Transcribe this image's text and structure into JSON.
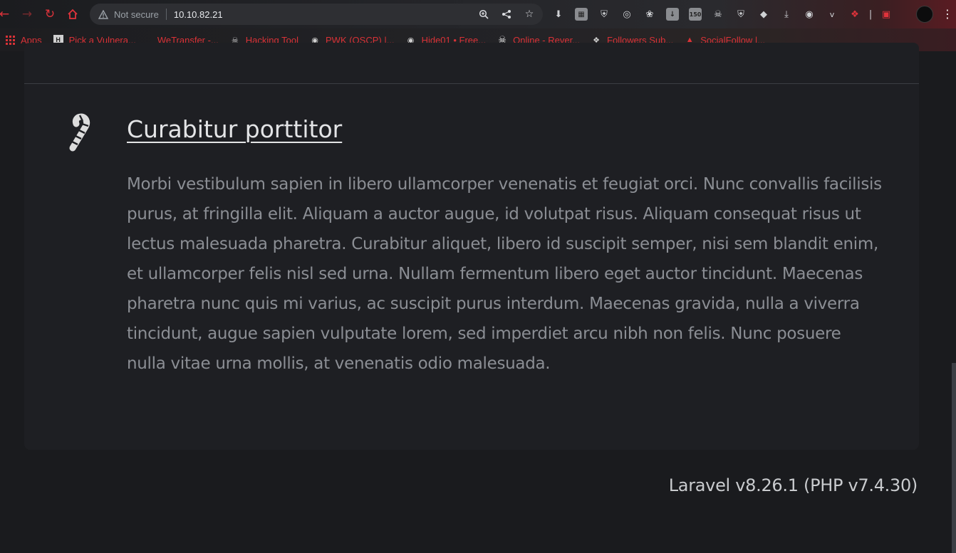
{
  "browser": {
    "security_label": "Not secure",
    "url": "10.10.82.21",
    "bookmarks": [
      {
        "label": "Apps",
        "icon": "apps-grid-icon"
      },
      {
        "label": "Pick a Vulnera...",
        "icon": "hacker-icon"
      },
      {
        "label": "WeTransfer -...",
        "icon": "wetransfer-icon"
      },
      {
        "label": "Hacking Tool",
        "icon": "skull-icon"
      },
      {
        "label": "PWK (OSCP) |...",
        "icon": "globe-icon"
      },
      {
        "label": "Hide01 • Free...",
        "icon": "globe-icon"
      },
      {
        "label": "Online - Rever...",
        "icon": "skull-icon"
      },
      {
        "label": "Followers Sub...",
        "icon": "puzzle-icon"
      },
      {
        "label": "SocialFollow |...",
        "icon": "social-icon"
      }
    ],
    "extension_badge": "150"
  },
  "feature": {
    "title": "Curabitur porttitor",
    "body": "Morbi vestibulum sapien in libero ullamcorper venenatis et feugiat orci. Nunc convallis facilisis purus, at fringilla elit. Aliquam a auctor augue, id volutpat risus. Aliquam consequat risus ut lectus malesuada pharetra. Curabitur aliquet, libero id suscipit semper, nisi sem blandit enim, et ullamcorper felis nisl sed urna. Nullam fermentum libero eget auctor tincidunt. Maecenas pharetra nunc quis mi varius, ac suscipit purus interdum. Maecenas gravida, nulla a viverra tincidunt, augue sapien vulputate lorem, sed imperdiet arcu nibh non felis. Nunc posuere nulla vitae urna mollis, at venenatis odio malesuada.",
    "icon": "candy-cane-icon"
  },
  "footer": {
    "version": "Laravel v8.26.1 (PHP v7.4.30)"
  },
  "colors": {
    "accent": "#e0333b",
    "page_bg": "#1a1b1e",
    "card_bg": "#1e1f23"
  }
}
